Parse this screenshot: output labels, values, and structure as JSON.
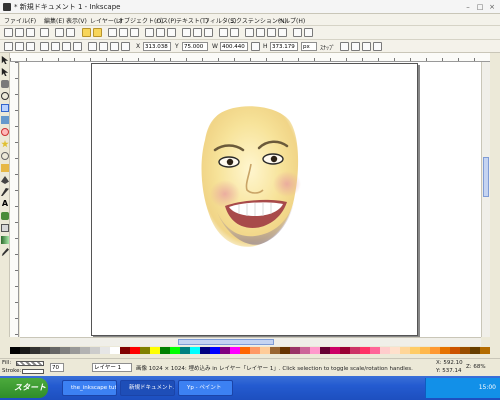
{
  "window": {
    "title": "* 新規ドキュメント 1 - Inkscape"
  },
  "menu": [
    "ファイル(F)",
    "編集(E)",
    "表示(V)",
    "レイヤー(L)",
    "オブジェクト(O)",
    "パス(P)",
    "テキスト(T)",
    "フィルタ(S)",
    "エクステンション(N)",
    "ヘルプ(H)"
  ],
  "controls": {
    "x_label": "X",
    "x_value": "313.038",
    "y_label": "Y",
    "y_value": "75.000",
    "w_label": "W",
    "w_value": "400.440",
    "h_label": "H",
    "h_value": "373.179",
    "unit": "px",
    "snap_label": "ｽﾅｯﾌﾟ"
  },
  "status": {
    "fill_label": "Fill:",
    "stroke_label": "Stroke:",
    "zoom": "70",
    "layer": "レイヤー 1",
    "message": "画像 1024 × 1024: 埋め込み in レイヤー「レイヤー 1」. Click selection to toggle scale/rotation handles.",
    "x_coord": "X: 592.10",
    "y_coord": "Y: 537.14",
    "z_value": "Z: 68%"
  },
  "taskbar": {
    "start_label": "スタート",
    "tasks": [
      "the_inkscape tuto...",
      "新規ドキュメント...",
      "Yp - ペイント"
    ],
    "clock": "15:00"
  },
  "colors": {
    "accent": "#245bd0",
    "start": "#3d9b34",
    "skin": "#f7e39a",
    "cheek": "#e9a4a0"
  },
  "palette": [
    "#000000",
    "#1a1a1a",
    "#333333",
    "#4d4d4d",
    "#666666",
    "#808080",
    "#999999",
    "#b3b3b3",
    "#cccccc",
    "#e6e6e6",
    "#ffffff",
    "#800000",
    "#ff0000",
    "#808000",
    "#ffff00",
    "#008000",
    "#00ff00",
    "#008080",
    "#00ffff",
    "#000080",
    "#0000ff",
    "#800080",
    "#ff00ff",
    "#ff6600",
    "#ff9966",
    "#ffcc99",
    "#996633",
    "#663300",
    "#993366",
    "#cc6699",
    "#ff99cc",
    "#660033",
    "#cc0066",
    "#990033",
    "#cc3366",
    "#ff3366",
    "#ff6699",
    "#ffcccc",
    "#ffe0cc",
    "#ffd699",
    "#ffcc66",
    "#ffb84d",
    "#ff9933",
    "#e67300",
    "#cc5200",
    "#994d00",
    "#663d00",
    "#b36b00"
  ]
}
